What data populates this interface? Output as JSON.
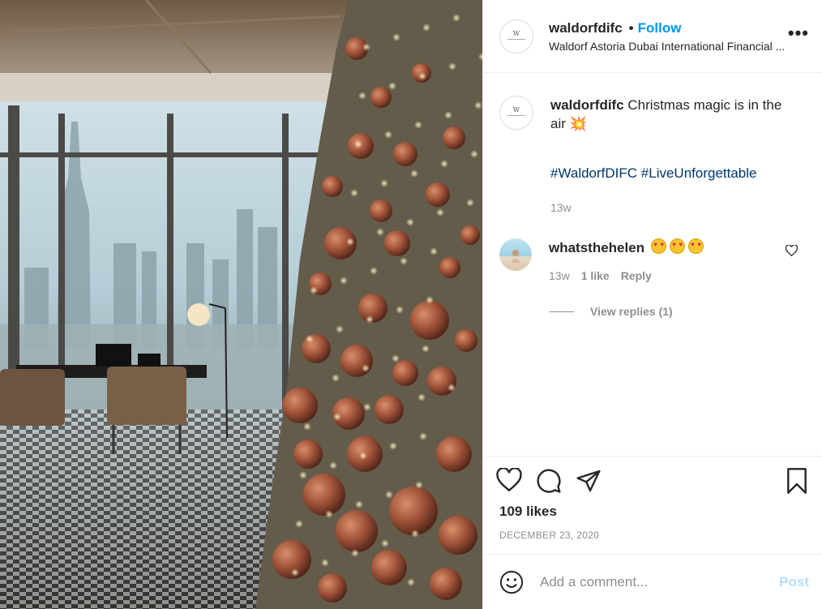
{
  "header": {
    "username": "waldorfdifc",
    "separator": "•",
    "follow_label": "Follow",
    "location": "Waldorf Astoria Dubai International Financial ...",
    "more_label": "•••"
  },
  "caption": {
    "username": "waldorfdifc",
    "text": "Christmas magic is in the air 💥",
    "hashtags": "#WaldorfDIFC #LiveUnforgettable",
    "age": "13w"
  },
  "comment": {
    "username": "whatsthehelen",
    "age": "13w",
    "likes": "1 like",
    "reply_label": "Reply",
    "emoji_count": 3
  },
  "view_replies": "View replies (1)",
  "post": {
    "likes": "109 likes",
    "date": "DECEMBER 23, 2020"
  },
  "comment_box": {
    "placeholder": "Add a comment...",
    "post_label": "Post"
  },
  "icons": {
    "like": "heart-icon",
    "comment": "comment-icon",
    "share": "share-icon",
    "save": "bookmark-icon",
    "emoji": "emoji-icon"
  },
  "colors": {
    "accent": "#0095f6",
    "hashtag": "#00376b",
    "muted": "#8e8e8e",
    "post_disabled": "#b2dffc"
  }
}
